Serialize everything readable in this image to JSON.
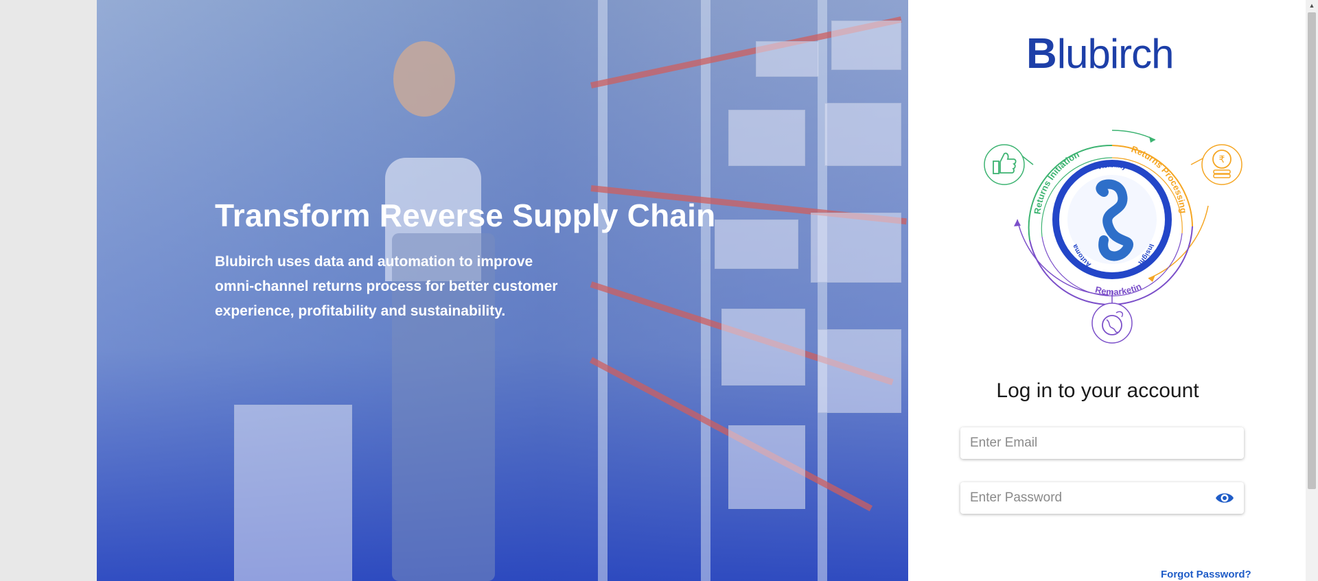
{
  "hero": {
    "title": "Transform Reverse Supply Chain",
    "subtitle_lines": [
      "Blubirch uses data and automation to improve",
      "omni-channel returns process for better customer",
      "experience, profitability and sustainability."
    ]
  },
  "brand": {
    "name": "Blubirch",
    "logo_initial": "B",
    "logo_rest": "lubirch",
    "color": "#1d3fa8"
  },
  "diagram": {
    "center_labels": [
      "Visibility",
      "Insight",
      "Automation"
    ],
    "ring_labels": [
      "Returns Initiation",
      "Returns Processing",
      "Remarketing"
    ],
    "icons": [
      "thumbs-up-icon",
      "rupee-coin-icon",
      "globe-icon"
    ],
    "colors": {
      "initiation": "#3cb371",
      "processing": "#f5a623",
      "remarketing": "#7b4fc9",
      "core": "#2346c8"
    }
  },
  "login": {
    "title": "Log in to your account",
    "email_placeholder": "Enter Email",
    "email_value": "",
    "password_placeholder": "Enter Password",
    "password_value": "",
    "forgot_label": "Forgot Password?"
  },
  "colors": {
    "accent": "#1f5cc7",
    "hero_overlay": "#2446c0"
  }
}
